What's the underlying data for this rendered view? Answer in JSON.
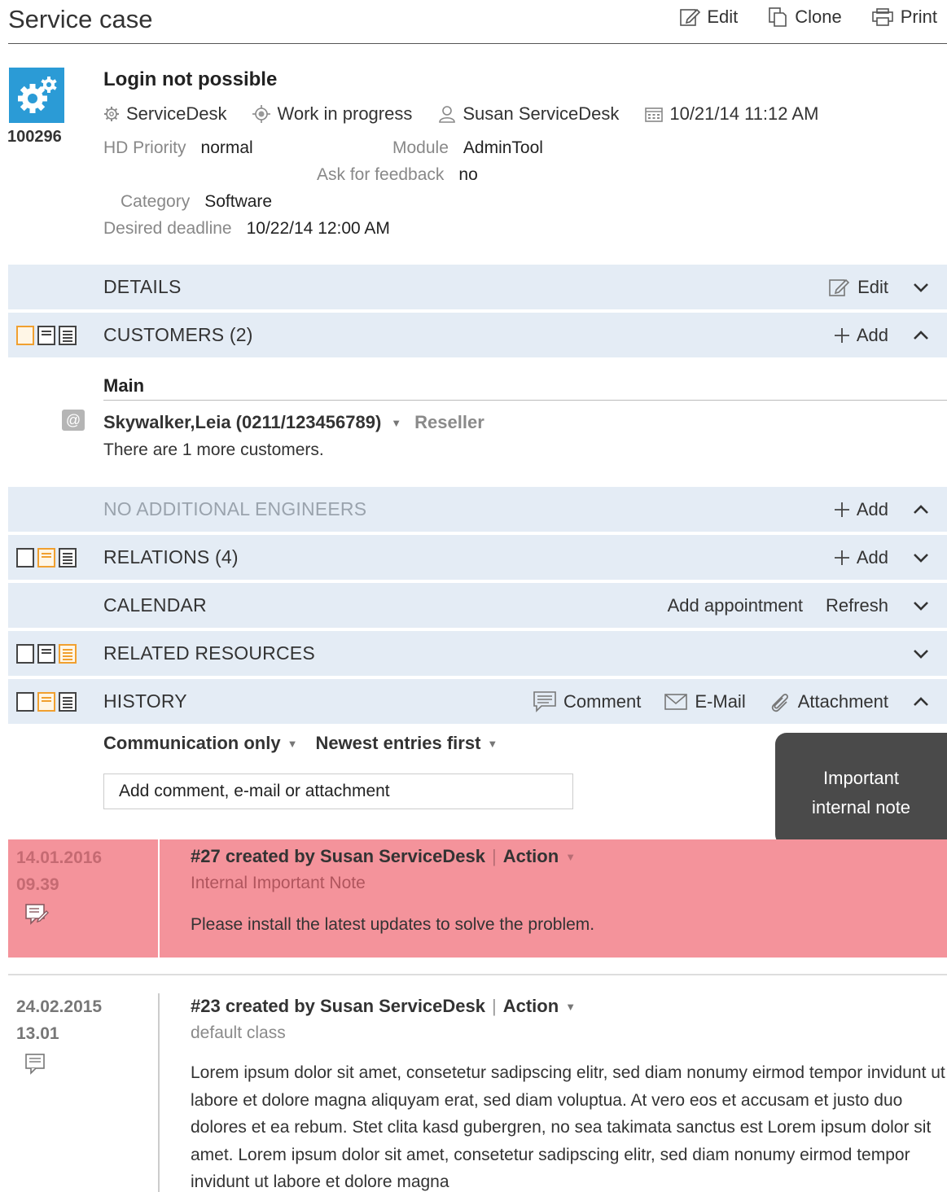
{
  "page": {
    "title": "Service case",
    "actions": [
      {
        "label": "Edit",
        "icon": "edit-icon"
      },
      {
        "label": "Clone",
        "icon": "clone-icon"
      },
      {
        "label": "Print",
        "icon": "print-icon"
      }
    ]
  },
  "case": {
    "id": "100296",
    "subject": "Login not possible",
    "accent_color": "#2b9bd6",
    "meta": {
      "queue": "ServiceDesk",
      "status": "Work in progress",
      "assignee": "Susan ServiceDesk",
      "created": "10/21/14 11:12 AM"
    },
    "fields": {
      "hd_priority_label": "HD Priority",
      "hd_priority_value": "normal",
      "module_label": "Module",
      "module_value": "AdminTool",
      "feedback_label": "Ask for feedback",
      "feedback_value": "no",
      "category_label": "Category",
      "category_value": "Software",
      "deadline_label": "Desired deadline",
      "deadline_value": "10/22/14 12:00 AM"
    }
  },
  "sections": {
    "details": {
      "title": "DETAILS",
      "edit_label": "Edit"
    },
    "customers": {
      "title": "CUSTOMERS (2)",
      "add_label": "Add"
    },
    "engineers": {
      "title": "NO ADDITIONAL ENGINEERS",
      "add_label": "Add"
    },
    "relations": {
      "title": "RELATIONS (4)",
      "add_label": "Add"
    },
    "calendar": {
      "title": "CALENDAR",
      "add_appointment_label": "Add appointment",
      "refresh_label": "Refresh"
    },
    "resources": {
      "title": "RELATED RESOURCES"
    },
    "history": {
      "title": "HISTORY",
      "comment_label": "Comment",
      "email_label": "E-Mail",
      "attachment_label": "Attachment"
    }
  },
  "customers": {
    "group_label": "Main",
    "name": "Skywalker,Leia (0211/123456789)",
    "role": "Reseller",
    "more_text": "There are 1 more customers."
  },
  "history": {
    "filter_type": "Communication only",
    "filter_order": "Newest entries first",
    "input_value": "Add comment, e-mail or attachment",
    "tooltip_line1": "Important",
    "tooltip_line2": "internal note",
    "important_color": "#f4939b",
    "entries": [
      {
        "date": "14.01.2016",
        "time": "09.39",
        "title": "#27 created by Susan ServiceDesk",
        "action_label": "Action",
        "class": "Internal Important Note",
        "text": "Please install the latest updates to solve the problem."
      },
      {
        "date": "24.02.2015",
        "time": "13.01",
        "title": "#23 created by Susan ServiceDesk",
        "action_label": "Action",
        "class": "default class",
        "text": "Lorem ipsum dolor sit amet, consetetur sadipscing elitr, sed diam nonumy eirmod tempor invidunt ut labore et dolore magna aliquyam erat, sed diam voluptua. At vero eos et accusam et justo duo dolores et ea rebum. Stet clita kasd gubergren, no sea takimata sanctus est Lorem ipsum dolor sit amet. Lorem ipsum dolor sit amet, consetetur sadipscing elitr, sed diam nonumy eirmod tempor invidunt ut labore et dolore magna"
      }
    ]
  }
}
